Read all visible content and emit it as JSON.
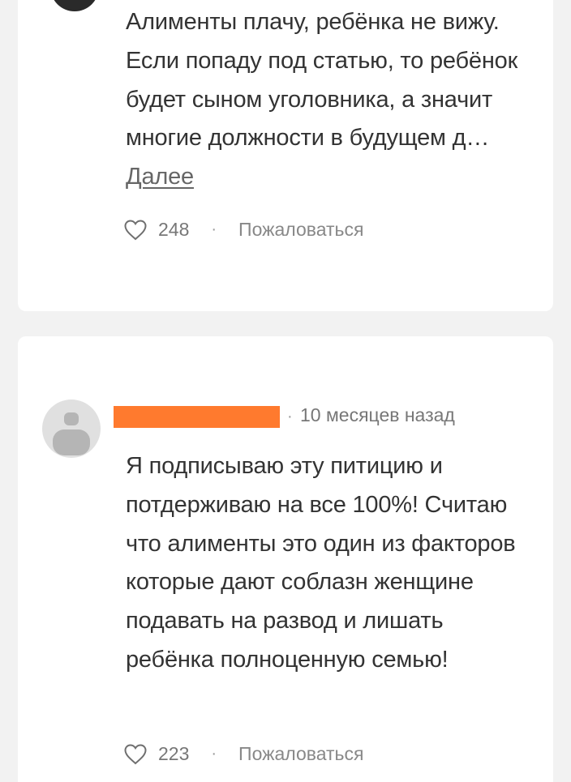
{
  "comments": [
    {
      "text": "Алименты плачу, ребёнка не вижу. Если попаду под статью, то ребёнок будет сыном уголовника, а значит многие должности в будущем д…",
      "more_label": "Далее",
      "likes": "248",
      "report_label": "Пожаловаться"
    },
    {
      "timestamp": "10 месяцев назад",
      "text": "Я подписываю эту питицию и потдерживаю на все 100%! Считаю что алименты это один из факторов которые дают соблазн женщине подавать на развод и лишать ребёнка полноценную семью!",
      "likes": "223",
      "report_label": "Пожаловаться"
    }
  ],
  "separator": "·",
  "colors": {
    "background": "#f2f2f2",
    "card": "#ffffff",
    "redaction": "#ff7a2e",
    "text": "#333333",
    "muted": "#777777"
  },
  "icons": {
    "like": "heart-outline-icon",
    "avatar_placeholder": "user-silhouette-icon"
  }
}
